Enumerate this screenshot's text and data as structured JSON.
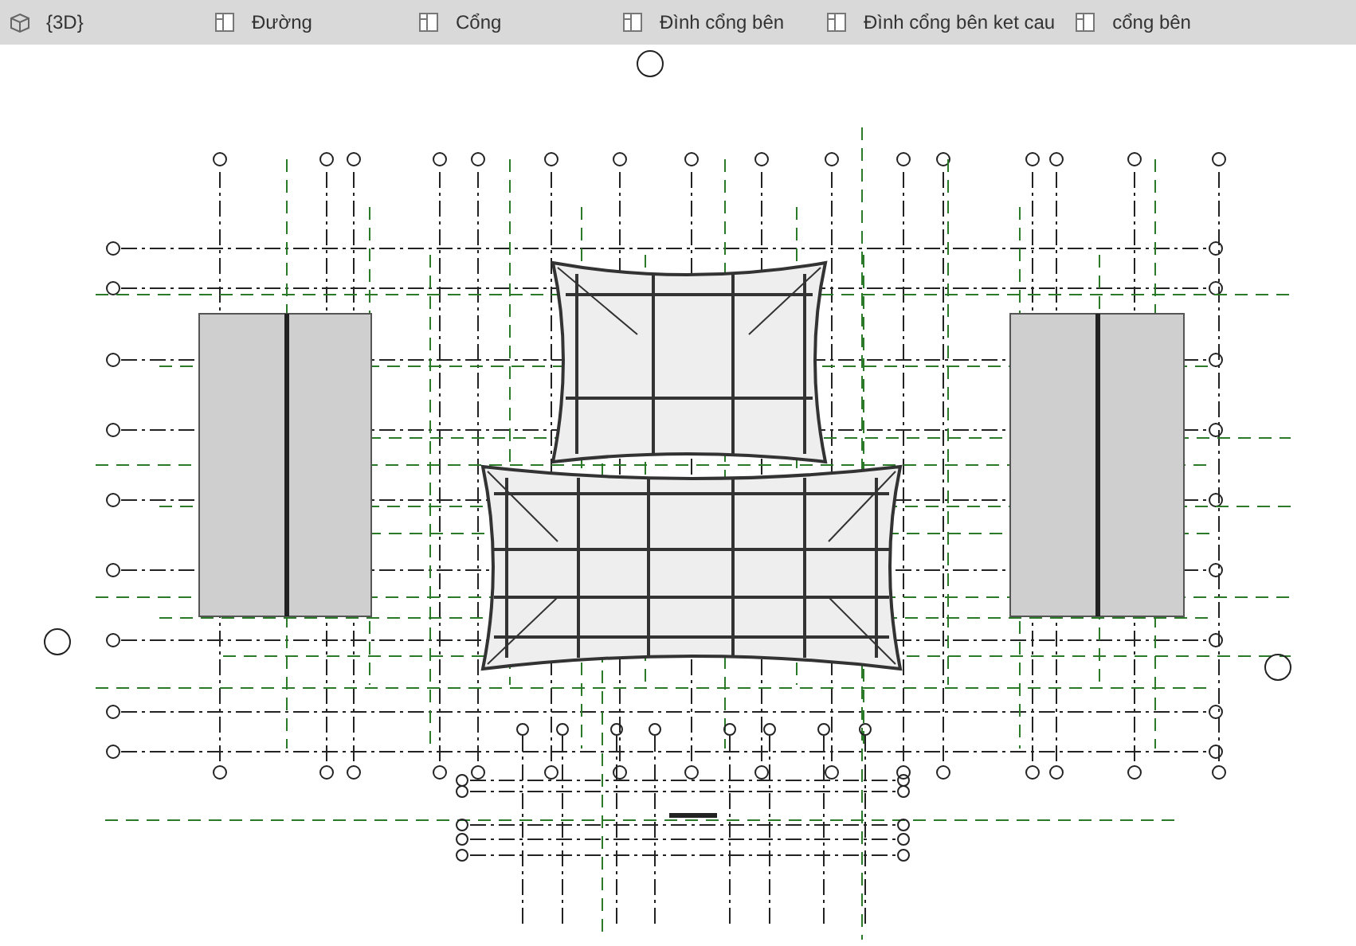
{
  "view_tabs": [
    {
      "label": "{3D}",
      "kind": "cube"
    },
    {
      "label": "Đường",
      "kind": "view"
    },
    {
      "label": "Cổng",
      "kind": "view"
    },
    {
      "label": "Đình cổng bên",
      "kind": "view"
    },
    {
      "label": "Đình cổng bên ket cau",
      "kind": "view"
    },
    {
      "label": "cổng bên",
      "kind": "view"
    }
  ]
}
